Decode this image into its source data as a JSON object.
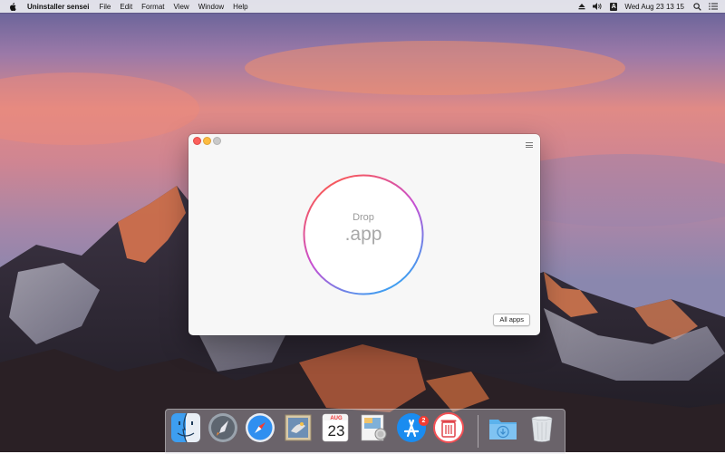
{
  "menubar": {
    "app_name": "Uninstaller sensei",
    "menus": [
      "File",
      "Edit",
      "Format",
      "View",
      "Window",
      "Help"
    ],
    "input_source": "A",
    "clock": "Wed Aug 23  13 15"
  },
  "window": {
    "drop_label": "Drop",
    "drop_ext": ".app",
    "all_apps_label": "All apps"
  },
  "dock": {
    "items": [
      "finder-icon",
      "launchpad-icon",
      "safari-icon",
      "mail-icon",
      "calendar-icon",
      "preview-icon",
      "app-store-icon",
      "uninstaller-icon",
      "downloads-folder-icon",
      "trash-icon"
    ],
    "calendar_month": "AUG",
    "calendar_day": "23",
    "app_store_badge": "2"
  },
  "colors": {
    "ring_gradient": [
      "#fd5a4c",
      "#c74fd3",
      "#2aaaf5"
    ],
    "close": "#fc605c",
    "minimize": "#fdbc40"
  }
}
